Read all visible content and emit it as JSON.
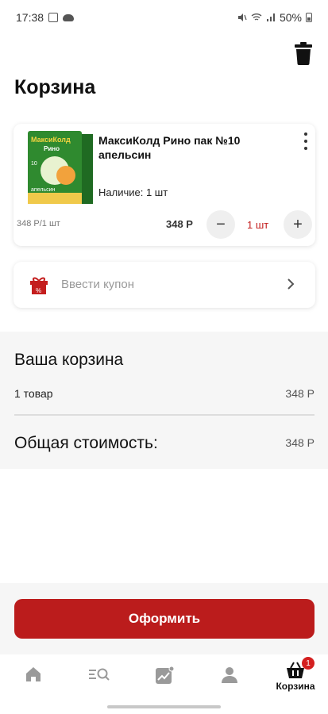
{
  "status_bar": {
    "time": "17:38",
    "battery": "50%"
  },
  "page": {
    "title": "Корзина"
  },
  "cart_item": {
    "name": "МаксиКолд Рино пак №10 апельсин",
    "stock": "Наличие: 1 шт",
    "unit_price": "348 Р/1 шт",
    "price": "348 Р",
    "quantity": "1 шт",
    "minus_label": "−",
    "plus_label": "+",
    "image": {
      "brand": "МаксиКолд",
      "sub": "Рино",
      "flavor": "апельсин",
      "count": "10"
    }
  },
  "coupon": {
    "label": "Ввести купон"
  },
  "summary": {
    "title": "Ваша корзина",
    "items_count": "1 товар",
    "items_price": "348 Р",
    "total_label": "Общая стоимость:",
    "total_price": "348 Р"
  },
  "checkout": {
    "label": "Оформить"
  },
  "bottom_nav": {
    "items": [
      {
        "icon": "home-icon"
      },
      {
        "icon": "catalog-search-icon"
      },
      {
        "icon": "trend-icon"
      },
      {
        "icon": "profile-icon"
      },
      {
        "icon": "cart-icon",
        "label": "Корзина",
        "badge": "1"
      }
    ]
  },
  "colors": {
    "accent": "#bb1c1c",
    "badge": "#d42020",
    "quantity": "#c41e1e"
  }
}
